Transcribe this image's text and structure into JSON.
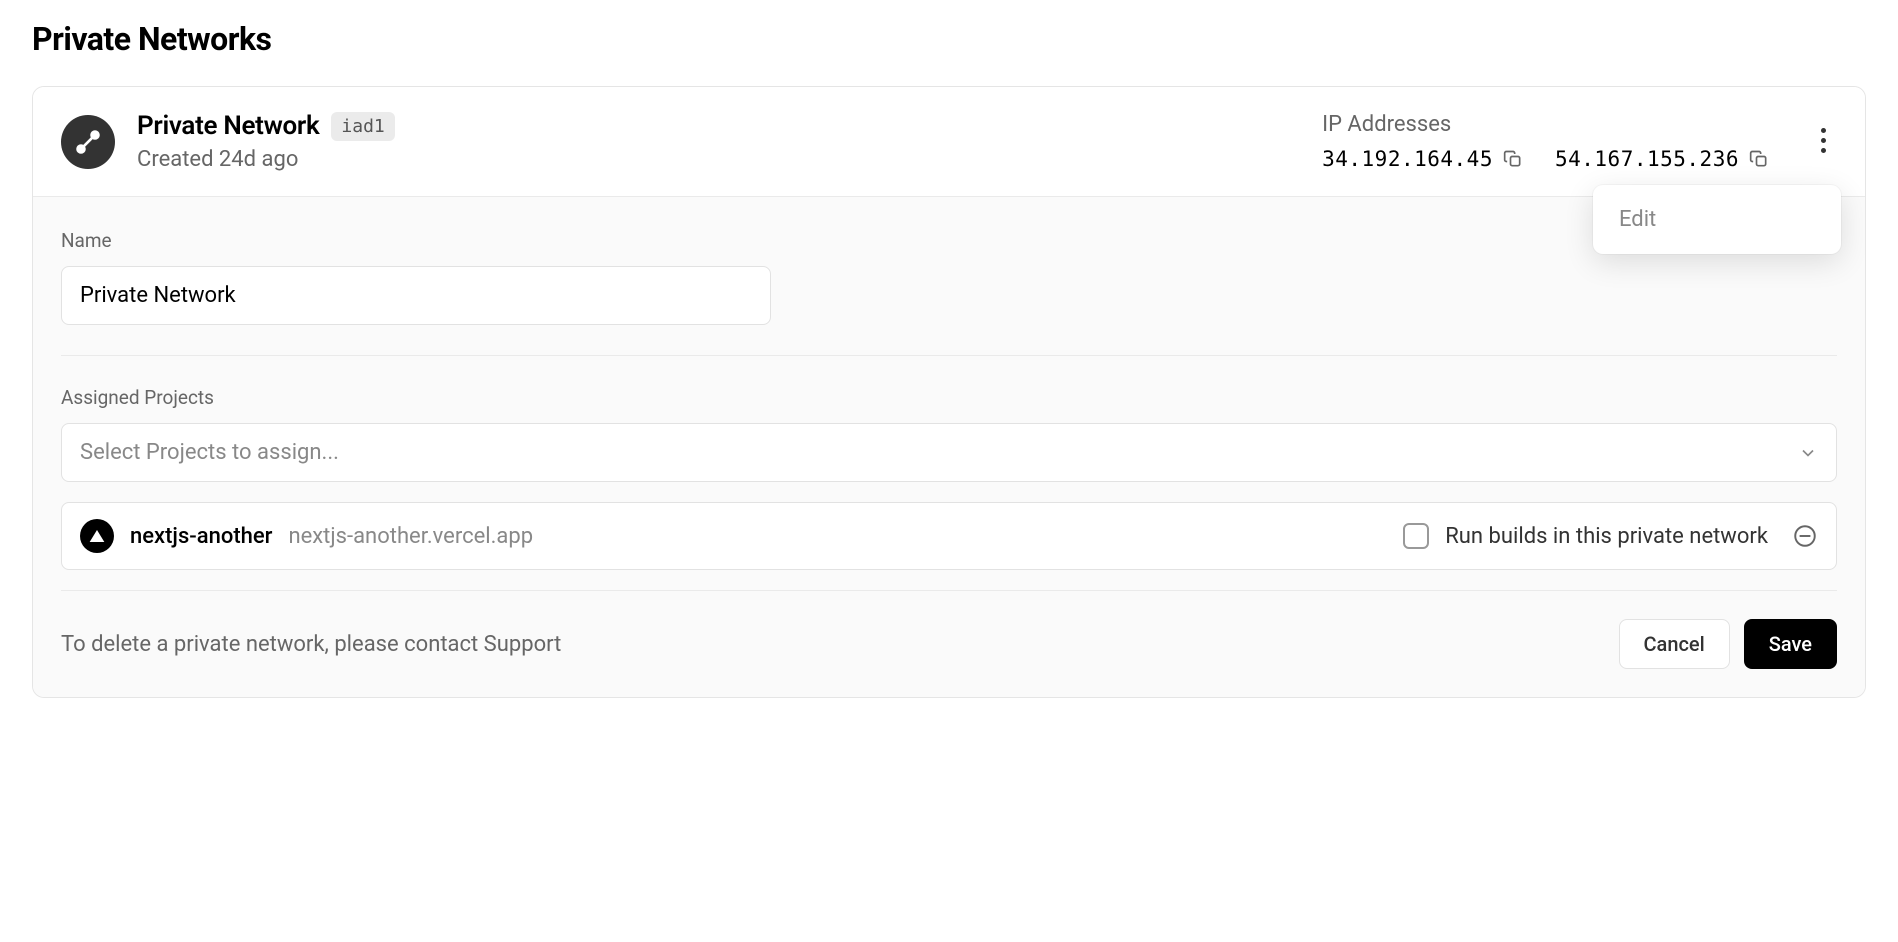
{
  "page": {
    "title": "Private Networks"
  },
  "network": {
    "name": "Private Network",
    "region": "iad1",
    "created": "Created 24d ago"
  },
  "ips": {
    "label": "IP Addresses",
    "list": [
      "34.192.164.45",
      "54.167.155.236"
    ]
  },
  "dropdown": {
    "edit": "Edit"
  },
  "form": {
    "name_label": "Name",
    "name_value": "Private Network",
    "assigned_label": "Assigned Projects",
    "select_placeholder": "Select Projects to assign..."
  },
  "project": {
    "name": "nextjs-another",
    "domain": "nextjs-another.vercel.app",
    "run_builds_label": "Run builds in this private network"
  },
  "footer": {
    "delete_text": "To delete a private network, please contact Support",
    "cancel": "Cancel",
    "save": "Save"
  }
}
